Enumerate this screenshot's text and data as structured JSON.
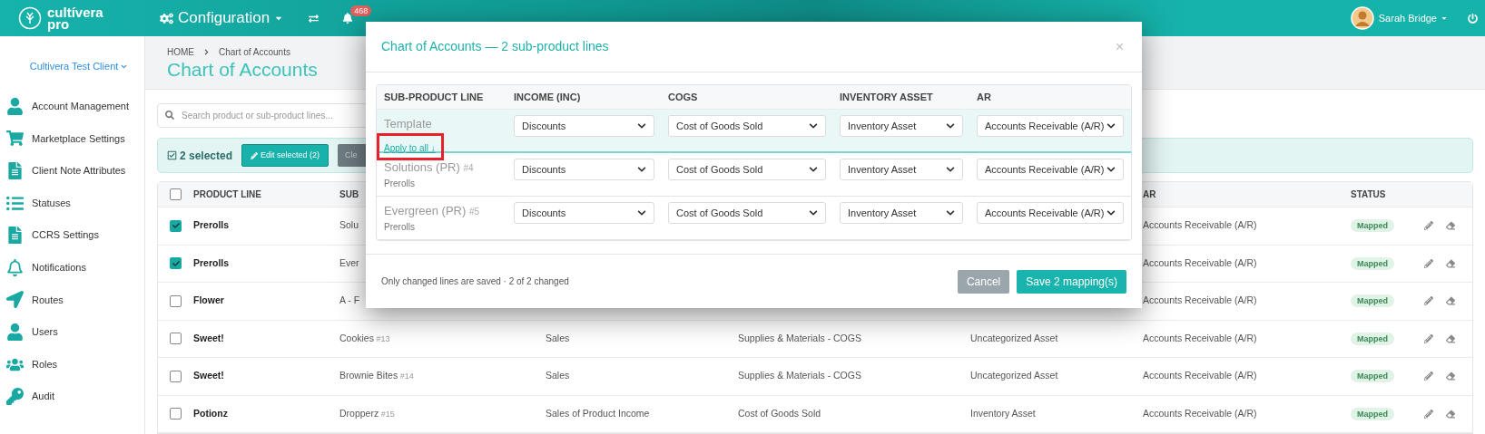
{
  "top_bar": {
    "logo": {
      "line_1": "cultívera",
      "line_2": "pro"
    },
    "menu": "Configuration",
    "notification_count": "468",
    "user": "Sarah Bridge"
  },
  "sidebar": {
    "client": "Cultivera Test Client",
    "items": [
      {
        "label": "Account Management"
      },
      {
        "label": "Marketplace Settings"
      },
      {
        "label": "Client Note Attributes"
      },
      {
        "label": "Statuses"
      },
      {
        "label": "CCRS Settings"
      },
      {
        "label": "Notifications"
      },
      {
        "label": "Routes"
      },
      {
        "label": "Users"
      },
      {
        "label": "Roles"
      },
      {
        "label": "Audit"
      }
    ]
  },
  "breadcrumb": [
    "HOME",
    "Chart of Accounts"
  ],
  "title": "Chart of Accounts",
  "search": {
    "placeholder": "Search product or sub-product lines..."
  },
  "selection_bar": {
    "count": "2 selected",
    "edit_button": "Edit selected (2)",
    "clear_button": "Cle"
  },
  "table": {
    "all_checked": false,
    "columns": {
      "product_line": "PRODUCT LINE",
      "column_2": "SUB",
      "ar": "AR",
      "status": "STATUS"
    },
    "rows": [
      {
        "checked": true,
        "product_line": "Prerolls",
        "sub_product_line": "Solu",
        "ar": "Accounts Receivable (A/R)",
        "status": "Mapped"
      },
      {
        "checked": true,
        "product_line": "Prerolls",
        "sub_product_line": "Ever",
        "ar": "Accounts Receivable (A/R)",
        "status": "Mapped"
      },
      {
        "checked": false,
        "product_line": "Flower",
        "sub_product_line": "A - F",
        "ar": "Accounts Receivable (A/R)",
        "status": "Mapped"
      },
      {
        "checked": false,
        "product_line": "Sweet!",
        "sub_product_line": "Cookies",
        "number": "#13",
        "income": "Sales",
        "cogs": "Supplies & Materials - COGS",
        "inventory_asset": "Uncategorized Asset",
        "ar": "Accounts Receivable (A/R)",
        "status": "Mapped"
      },
      {
        "checked": false,
        "product_line": "Sweet!",
        "sub_product_line": "Brownie Bites",
        "number": "#14",
        "income": "Sales",
        "cogs": "Supplies & Materials - COGS",
        "inventory_asset": "Uncategorized Asset",
        "ar": "Accounts Receivable (A/R)",
        "status": "Mapped"
      },
      {
        "checked": false,
        "product_line": "Potionz",
        "sub_product_line": "Dropperz",
        "number": "#15",
        "income": "Sales of Product Income",
        "cogs": "Cost of Goods Sold",
        "inventory_asset": "Inventory Asset",
        "ar": "Accounts Receivable (A/R)",
        "status": "Mapped"
      }
    ]
  },
  "modal": {
    "title": "Chart of Accounts — 2 sub-product lines",
    "close": "×",
    "columns": [
      "SUB-PRODUCT LINE",
      "INCOME (INC)",
      "COGS",
      "INVENTORY ASSET",
      "AR"
    ],
    "rows": [
      {
        "kind": "template",
        "name": "Template",
        "link": "Apply to all ↓",
        "income": "Discounts",
        "cogs": "Cost of Goods Sold",
        "inventory_asset": "Inventory Asset",
        "ar": "Accounts Receivable (A/R)"
      },
      {
        "kind": "line",
        "name": "Solutions (PR)",
        "number": "#4",
        "product_line": "Prerolls",
        "income": "Discounts",
        "cogs": "Cost of Goods Sold",
        "inventory_asset": "Inventory Asset",
        "ar": "Accounts Receivable (A/R)"
      },
      {
        "kind": "line",
        "name": "Evergreen (PR)",
        "number": "#5",
        "product_line": "Prerolls",
        "income": "Discounts",
        "cogs": "Cost of Goods Sold",
        "inventory_asset": "Inventory Asset",
        "ar": "Accounts Receivable (A/R)"
      }
    ],
    "footer_note": "Only changed lines are saved · 2 of 2 changed",
    "cancel_button": "Cancel",
    "save_button": "Save 2 mapping(s)"
  }
}
